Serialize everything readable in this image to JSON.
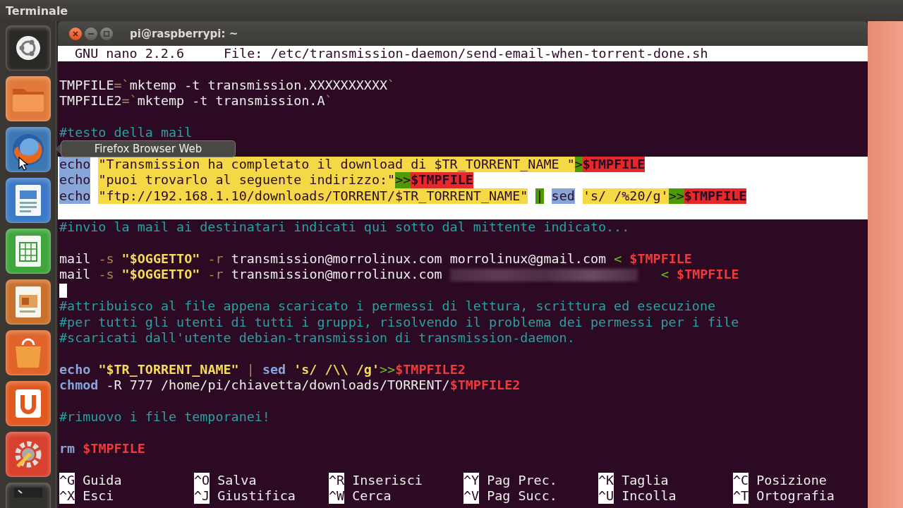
{
  "top_panel": {
    "title": "Terminale"
  },
  "launcher": [
    {
      "kind": "dash"
    },
    {
      "kind": "files"
    },
    {
      "kind": "browser"
    },
    {
      "kind": "writer"
    },
    {
      "kind": "calc"
    },
    {
      "kind": "impress"
    },
    {
      "kind": "store"
    },
    {
      "kind": "one"
    },
    {
      "kind": "settings"
    },
    {
      "kind": "terminal"
    }
  ],
  "tooltip": "Firefox Browser Web",
  "window": {
    "title": "pi@raspberrypi: ~"
  },
  "nano": {
    "version": "GNU nano 2.2.6",
    "file": "File: /etc/transmission-daemon/send-email-when-torrent-done.sh"
  },
  "lines": [
    {
      "selected": false,
      "cursor": false
    },
    {
      "selected": false,
      "cursor": false,
      "segments": [
        {
          "t": "TMPFILE",
          "kind": "text"
        },
        {
          "t": "=`",
          "kind": "flag"
        },
        {
          "t": "mktemp -t transmission.XXXXXXXXXX",
          "kind": "text"
        },
        {
          "t": "`",
          "kind": "flag"
        }
      ]
    },
    {
      "selected": false,
      "cursor": false,
      "segments": [
        {
          "t": "TMPFILE2",
          "kind": "text"
        },
        {
          "t": "=`",
          "kind": "flag"
        },
        {
          "t": "mktemp -t transmission.A",
          "kind": "text"
        },
        {
          "t": "`",
          "kind": "flag"
        }
      ]
    },
    {
      "selected": false,
      "cursor": false
    },
    {
      "selected": false,
      "cursor": false,
      "segments": [
        {
          "t": "#testo della mail",
          "kind": "comment"
        }
      ]
    },
    {
      "selected": false,
      "cursor": false
    },
    {
      "selected": true,
      "cursor": false,
      "segments": [
        {
          "t": "echo",
          "kind": "keyword"
        },
        {
          "t": " \"Transmission ha completato il download di $TR_TORRENT_NAME \"",
          "kind": "string"
        },
        {
          "t": ">",
          "kind": "op"
        },
        {
          "t": "$TMPFILE",
          "kind": "var"
        }
      ]
    },
    {
      "selected": true,
      "cursor": false,
      "segments": [
        {
          "t": "echo",
          "kind": "keyword"
        },
        {
          "t": " \"puoi trovarlo al seguente indirizzo:\"",
          "kind": "string"
        },
        {
          "t": ">>",
          "kind": "op"
        },
        {
          "t": "$TMPFILE",
          "kind": "var"
        }
      ]
    },
    {
      "selected": true,
      "cursor": false,
      "segments": [
        {
          "t": "echo",
          "kind": "keyword"
        },
        {
          "t": " \"ftp://192.168.1.10/downloads/TORRENT/$TR_TORRENT_NAME\"",
          "kind": "string"
        },
        {
          "t": " |",
          "kind": "op"
        },
        {
          "t": " sed",
          "kind": "keyword"
        },
        {
          "t": " 's/ /%20/g'",
          "kind": "string"
        },
        {
          "t": ">>",
          "kind": "op"
        },
        {
          "t": "$TMPFILE",
          "kind": "var"
        }
      ]
    },
    {
      "selected": true,
      "cursor": false
    },
    {
      "selected": false,
      "cursor": false,
      "segments": [
        {
          "t": "#invio la mail ai destinatari indicati qui sotto dal mittente indicato...",
          "kind": "comment"
        }
      ]
    },
    {
      "selected": false,
      "cursor": false
    },
    {
      "selected": false,
      "cursor": false,
      "segments": [
        {
          "t": "mail ",
          "kind": "text"
        },
        {
          "t": "-s",
          "kind": "flag"
        },
        {
          "t": " \"$OGGETTO\"",
          "kind": "string"
        },
        {
          "t": " -r",
          "kind": "flag"
        },
        {
          "t": " transmission@morrolinux.com morrolinux@gmail.com ",
          "kind": "text"
        },
        {
          "t": "<",
          "kind": "op"
        },
        {
          "t": " $TMPFILE",
          "kind": "var"
        }
      ]
    },
    {
      "selected": false,
      "cursor": false,
      "segments": [
        {
          "t": "mail ",
          "kind": "text"
        },
        {
          "t": "-s",
          "kind": "flag"
        },
        {
          "t": " \"$OGGETTO\"",
          "kind": "string"
        },
        {
          "t": " -r",
          "kind": "flag"
        },
        {
          "t": " transmission@morrolinux.com ",
          "kind": "text"
        },
        {
          "kind": "redacted"
        },
        {
          "t": "   <",
          "kind": "op"
        },
        {
          "t": " $TMPFILE",
          "kind": "var"
        }
      ]
    },
    {
      "selected": false,
      "cursor": true
    },
    {
      "selected": false,
      "cursor": false,
      "segments": [
        {
          "t": "#attribuisco al file appena scaricato i permessi di lettura, scrittura ed esecuzione",
          "kind": "comment"
        }
      ]
    },
    {
      "selected": false,
      "cursor": false,
      "segments": [
        {
          "t": "#per tutti gli utenti di tutti i gruppi, risolvendo il problema dei permessi per i file",
          "kind": "comment"
        }
      ]
    },
    {
      "selected": false,
      "cursor": false,
      "segments": [
        {
          "t": "#scaricati dall'utente debian-transmission di transmission-daemon.",
          "kind": "comment"
        }
      ]
    },
    {
      "selected": false,
      "cursor": false
    },
    {
      "selected": false,
      "cursor": false,
      "segments": [
        {
          "t": "echo",
          "kind": "keyword"
        },
        {
          "t": " \"$TR_TORRENT_NAME\"",
          "kind": "string"
        },
        {
          "t": " |",
          "kind": "flag"
        },
        {
          "t": " sed",
          "kind": "keyword"
        },
        {
          "t": " 's/ /\\\\ /g'",
          "kind": "string"
        },
        {
          "t": ">>",
          "kind": "op"
        },
        {
          "t": "$TMPFILE2",
          "kind": "var"
        }
      ]
    },
    {
      "selected": false,
      "cursor": false,
      "segments": [
        {
          "t": "chmod",
          "kind": "keyword"
        },
        {
          "t": " -R 777 /home/pi/chiavetta/downloads/TORRENT/",
          "kind": "text"
        },
        {
          "t": "$TMPFILE2",
          "kind": "var"
        }
      ]
    },
    {
      "selected": false,
      "cursor": false
    },
    {
      "selected": false,
      "cursor": false,
      "segments": [
        {
          "t": "#rimuovo i file temporanei!",
          "kind": "comment"
        }
      ]
    },
    {
      "selected": false,
      "cursor": false
    },
    {
      "selected": false,
      "cursor": false,
      "segments": [
        {
          "t": "rm",
          "kind": "keyword"
        },
        {
          "t": " $TMPFILE",
          "kind": "var"
        }
      ]
    },
    {
      "selected": false,
      "cursor": false
    }
  ],
  "shortcuts": [
    {
      "key": "^G",
      "label": "Guida"
    },
    {
      "key": "^O",
      "label": "Salva"
    },
    {
      "key": "^R",
      "label": "Inserisci"
    },
    {
      "key": "^Y",
      "label": "Pag Prec."
    },
    {
      "key": "^K",
      "label": "Taglia"
    },
    {
      "key": "^C",
      "label": "Posizione"
    },
    {
      "key": "^X",
      "label": "Esci"
    },
    {
      "key": "^J",
      "label": "Giustifica"
    },
    {
      "key": "^W",
      "label": "Cerca"
    },
    {
      "key": "^V",
      "label": "Pag Succ."
    },
    {
      "key": "^U",
      "label": "Incolla"
    },
    {
      "key": "^T",
      "label": "Ortografia"
    }
  ]
}
